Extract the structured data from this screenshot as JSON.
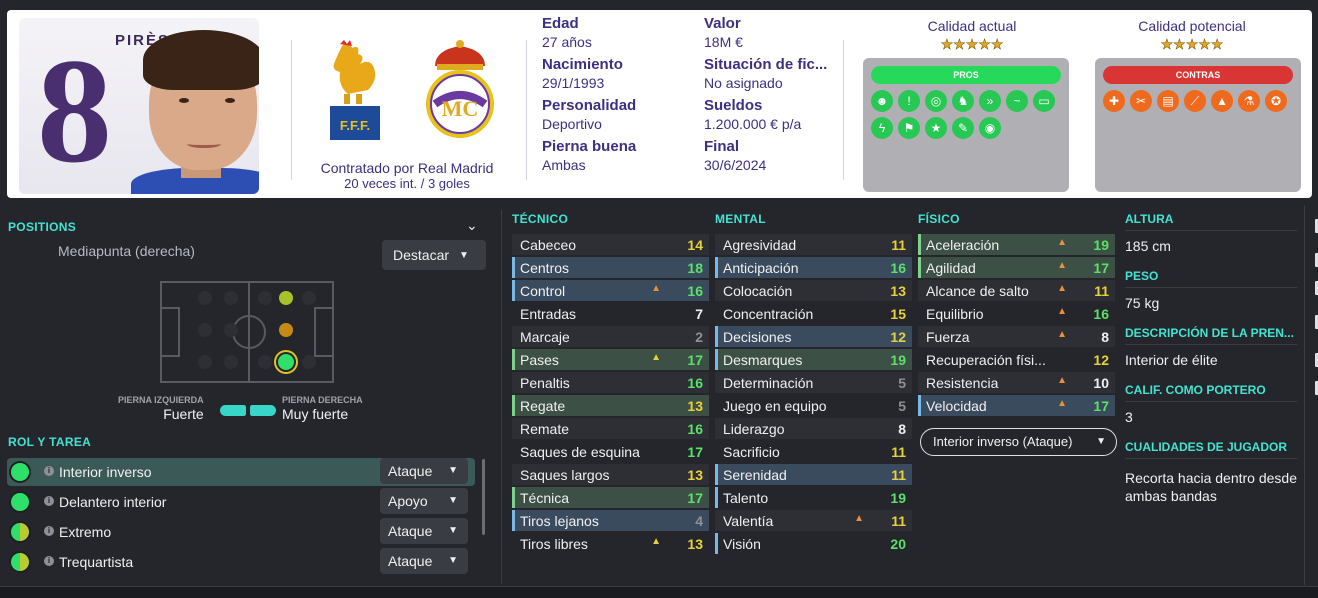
{
  "player": {
    "shirt_name": "PIRÈS",
    "shirt_number": "8",
    "contract_line": "Contratado por Real Madrid",
    "caps_line": "20 veces int. / 3 goles"
  },
  "info": {
    "col1": [
      {
        "label": "Edad",
        "value": "27 años"
      },
      {
        "label": "Nacimiento",
        "value": "29/1/1993"
      },
      {
        "label": "Personalidad",
        "value": "Deportivo"
      },
      {
        "label": "Pierna buena",
        "value": "Ambas"
      }
    ],
    "col2": [
      {
        "label": "Valor",
        "value": "18M €"
      },
      {
        "label": "Situación de fic...",
        "value": "No asignado"
      },
      {
        "label": "Sueldos",
        "value": "1.200.000 € p/a"
      },
      {
        "label": "Final",
        "value": "30/6/2024"
      }
    ]
  },
  "quality": {
    "current_label": "Calidad actual",
    "potential_label": "Calidad potencial",
    "current_stars": "★★★★★",
    "potential_stars": "★★★★★"
  },
  "traits": {
    "pros_label": "PROS",
    "cons_label": "CONTRAS",
    "pros_color": "#27d95a",
    "cons_color": "#d93535",
    "pros_icons": [
      "brain-icon",
      "exclaim-ball-icon",
      "target-icon",
      "foot-icon",
      "dribble-icon",
      "wave-icon",
      "pitch-icon",
      "lightning-icon",
      "flag-icon",
      "star-icon",
      "boot-icon",
      "eye-icon"
    ],
    "cons_icons": [
      "cross-icon",
      "scissors-icon",
      "card-icon",
      "slide-icon",
      "cone-icon",
      "flask-icon",
      "medal-icon"
    ],
    "pros_glyphs": [
      "☻",
      "!",
      "◎",
      "♞",
      "»",
      "~",
      "▭",
      "ϟ",
      "⚑",
      "★",
      "✎",
      "◉"
    ],
    "cons_glyphs": [
      "✚",
      "✂",
      "▤",
      "⟋",
      "▲",
      "⚗",
      "✪"
    ]
  },
  "positions": {
    "title": "POSITIONS",
    "position_name": "Mediapunta (derecha)",
    "highlight_button": "Destacar",
    "left_foot_label": "PIERNA IZQUIERDA",
    "left_foot_value": "Fuerte",
    "right_foot_label": "PIERNA DERECHA",
    "right_foot_value": "Muy fuerte"
  },
  "roles": {
    "title": "ROL Y TAREA",
    "items": [
      {
        "name": "Interior inverso",
        "duty": "Ataque"
      },
      {
        "name": "Delantero interior",
        "duty": "Apoyo"
      },
      {
        "name": "Extremo",
        "duty": "Ataque"
      },
      {
        "name": "Trequartista",
        "duty": "Ataque"
      }
    ]
  },
  "attributes": {
    "tecnico_title": "TÉCNICO",
    "mental_title": "MENTAL",
    "fisico_title": "FÍSICO",
    "tecnico": [
      {
        "name": "Cabeceo",
        "value": "14"
      },
      {
        "name": "Centros",
        "value": "18"
      },
      {
        "name": "Control",
        "value": "16"
      },
      {
        "name": "Entradas",
        "value": "7"
      },
      {
        "name": "Marcaje",
        "value": "2"
      },
      {
        "name": "Pases",
        "value": "17"
      },
      {
        "name": "Penaltis",
        "value": "16"
      },
      {
        "name": "Regate",
        "value": "13"
      },
      {
        "name": "Remate",
        "value": "16"
      },
      {
        "name": "Saques de esquina",
        "value": "17"
      },
      {
        "name": "Saques largos",
        "value": "13"
      },
      {
        "name": "Técnica",
        "value": "17"
      },
      {
        "name": "Tiros lejanos",
        "value": "4"
      },
      {
        "name": "Tiros libres",
        "value": "13"
      }
    ],
    "mental": [
      {
        "name": "Agresividad",
        "value": "11"
      },
      {
        "name": "Anticipación",
        "value": "16"
      },
      {
        "name": "Colocación",
        "value": "13"
      },
      {
        "name": "Concentración",
        "value": "15"
      },
      {
        "name": "Decisiones",
        "value": "12"
      },
      {
        "name": "Desmarques",
        "value": "19"
      },
      {
        "name": "Determinación",
        "value": "5"
      },
      {
        "name": "Juego en equipo",
        "value": "5"
      },
      {
        "name": "Liderazgo",
        "value": "8"
      },
      {
        "name": "Sacrificio",
        "value": "11"
      },
      {
        "name": "Serenidad",
        "value": "11"
      },
      {
        "name": "Talento",
        "value": "19"
      },
      {
        "name": "Valentía",
        "value": "11"
      },
      {
        "name": "Visión",
        "value": "20"
      }
    ],
    "fisico": [
      {
        "name": "Aceleración",
        "value": "19"
      },
      {
        "name": "Agilidad",
        "value": "17"
      },
      {
        "name": "Alcance de salto",
        "value": "11"
      },
      {
        "name": "Equilibrio",
        "value": "16"
      },
      {
        "name": "Fuerza",
        "value": "8"
      },
      {
        "name": "Recuperación físi...",
        "value": "12"
      },
      {
        "name": "Resistencia",
        "value": "10"
      },
      {
        "name": "Velocidad",
        "value": "17"
      }
    ],
    "role_select": "Interior inverso (Ataque)"
  },
  "side": {
    "height_label": "ALTURA",
    "height_value": "185 cm",
    "weight_label": "PESO",
    "weight_value": "75 kg",
    "desc_label": "DESCRIPCIÓN DE LA PREN...",
    "desc_value": "Interior de élite",
    "gk_label": "CALIF. COMO PORTERO",
    "gk_value": "3",
    "qualities_label": "CUALIDADES DE JUGADOR",
    "qualities_value": "Recorta hacia dentro desde ambas bandas"
  }
}
